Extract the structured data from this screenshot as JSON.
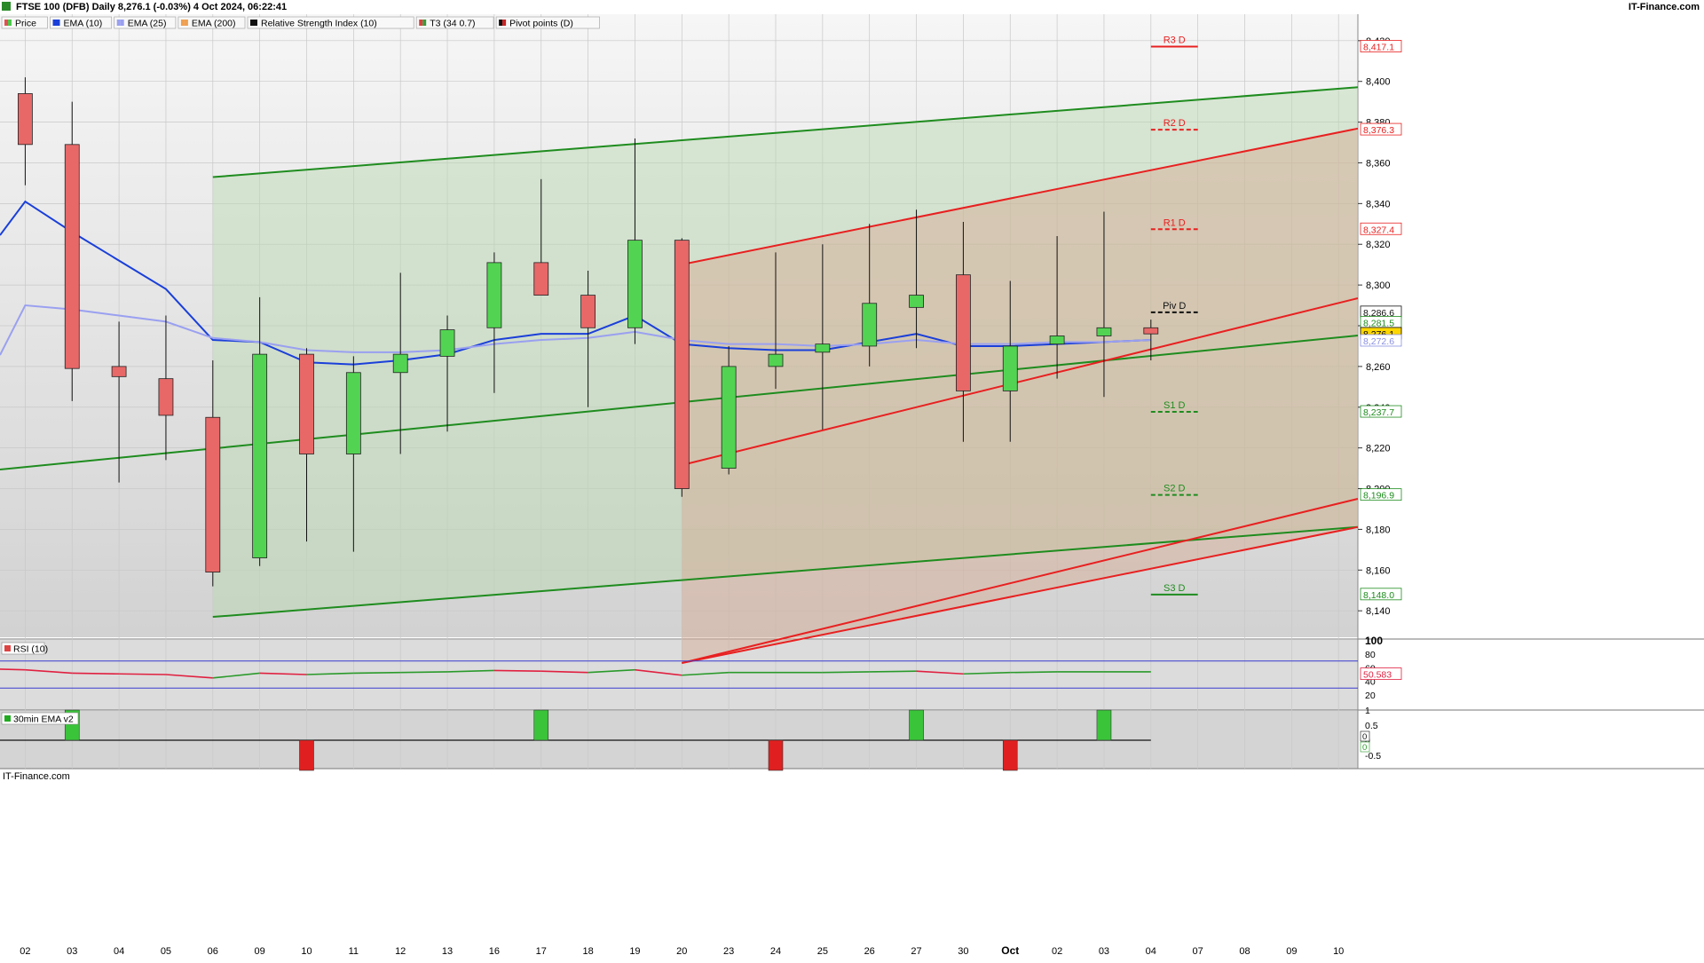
{
  "header": {
    "title": "FTSE 100 (DFB) Daily 8,276.1 (-0.03%) 4 Oct 2024, 06:22:41",
    "brand": "IT-Finance.com",
    "watermark": "IT-Finance.com"
  },
  "legend": [
    {
      "label": "Price",
      "color": "#e05252",
      "color2": "#4cc84c"
    },
    {
      "label": "EMA (10)",
      "color": "#1a3fd9"
    },
    {
      "label": "EMA (25)",
      "color": "#9aa0f0"
    },
    {
      "label": "EMA (200)",
      "color": "#f0a050"
    },
    {
      "label": "Relative Strength Index (10)",
      "color": "#111111"
    },
    {
      "label": "T3 (34 0.7)",
      "color": "#d94040",
      "color2": "#3a9a3a"
    },
    {
      "label": "Pivot points (D)",
      "color": "#111111",
      "color2": "#cc2222"
    }
  ],
  "colors": {
    "up": "#52d452",
    "down": "#e86868",
    "ema10": "#1a3fd9",
    "ema25": "#9aa0f0",
    "green_line": "#1e8c1e",
    "red_line": "#e82020",
    "rsi_up": "#2a9a2a",
    "rsi_down": "#e02040"
  },
  "chart_data": {
    "type": "candlestick",
    "x_tick_labels": [
      "02",
      "03",
      "04",
      "05",
      "06",
      "09",
      "10",
      "11",
      "12",
      "13",
      "16",
      "17",
      "18",
      "19",
      "20",
      "23",
      "24",
      "25",
      "26",
      "27",
      "30",
      "Oct",
      "02",
      "03",
      "04",
      "07",
      "08",
      "09",
      "10"
    ],
    "y_ticks": [
      "8,140",
      "8,160",
      "8,180",
      "8,200",
      "8,220",
      "8,240",
      "8,260",
      "8,280",
      "8,300",
      "8,320",
      "8,340",
      "8,360",
      "8,380",
      "8,400",
      "8,420"
    ],
    "ylim": [
      8127,
      8433
    ],
    "candles": [
      {
        "o": 8394,
        "h": 8402,
        "l": 8349,
        "c": 8369
      },
      {
        "o": 8369,
        "h": 8390,
        "l": 8243,
        "c": 8259
      },
      {
        "o": 8260,
        "h": 8282,
        "l": 8203,
        "c": 8255
      },
      {
        "o": 8254,
        "h": 8285,
        "l": 8214,
        "c": 8236
      },
      {
        "o": 8235,
        "h": 8263,
        "l": 8152,
        "c": 8159
      },
      {
        "o": 8166,
        "h": 8294,
        "l": 8162,
        "c": 8266
      },
      {
        "o": 8266,
        "h": 8269,
        "l": 8174,
        "c": 8217
      },
      {
        "o": 8217,
        "h": 8265,
        "l": 8169,
        "c": 8257
      },
      {
        "o": 8257,
        "h": 8306,
        "l": 8217,
        "c": 8266
      },
      {
        "o": 8265,
        "h": 8285,
        "l": 8228,
        "c": 8278
      },
      {
        "o": 8279,
        "h": 8316,
        "l": 8247,
        "c": 8311
      },
      {
        "o": 8311,
        "h": 8352,
        "l": 8305,
        "c": 8295
      },
      {
        "o": 8295,
        "h": 8307,
        "l": 8240,
        "c": 8279
      },
      {
        "o": 8279,
        "h": 8372,
        "l": 8271,
        "c": 8322
      },
      {
        "o": 8322,
        "h": 8323,
        "l": 8196,
        "c": 8200
      },
      {
        "o": 8210,
        "h": 8270,
        "l": 8207,
        "c": 8260
      },
      {
        "o": 8260,
        "h": 8316,
        "l": 8249,
        "c": 8266
      },
      {
        "o": 8267,
        "h": 8320,
        "l": 8229,
        "c": 8271
      },
      {
        "o": 8270,
        "h": 8330,
        "l": 8260,
        "c": 8291
      },
      {
        "o": 8289,
        "h": 8337,
        "l": 8269,
        "c": 8295
      },
      {
        "o": 8305,
        "h": 8331,
        "l": 8223,
        "c": 8248
      },
      {
        "o": 8248,
        "h": 8302,
        "l": 8223,
        "c": 8270
      },
      {
        "o": 8271,
        "h": 8324,
        "l": 8254,
        "c": 8275
      },
      {
        "o": 8275,
        "h": 8336,
        "l": 8245,
        "c": 8279
      },
      {
        "o": 8279,
        "h": 8283,
        "l": 8263,
        "c": 8276
      }
    ],
    "ema10": [
      8341,
      8326,
      8312,
      8298,
      8273,
      8272,
      8262,
      8261,
      8263,
      8266,
      8273,
      8276,
      8276,
      8285,
      8271,
      8269,
      8268,
      8268,
      8272,
      8276,
      8270,
      8270,
      8271,
      8272,
      8273
    ],
    "ema25": [
      8290,
      8288,
      8285,
      8282,
      8274,
      8272,
      8268,
      8267,
      8267,
      8268,
      8271,
      8273,
      8274,
      8277,
      8273,
      8271,
      8271,
      8270,
      8271,
      8273,
      8271,
      8271,
      8272,
      8272,
      8273
    ],
    "ema_fills": {
      "upper_channel_start": 8353,
      "lower_channel_start": 8137
    },
    "price_labels": [
      {
        "text": "8,417.1",
        "value": 8417.1,
        "color": "#e82020",
        "bg": "#ffffff"
      },
      {
        "text": "8,376.3",
        "value": 8376.3,
        "color": "#e82020",
        "bg": "#ffffff"
      },
      {
        "text": "8,327.4",
        "value": 8327.4,
        "color": "#e82020",
        "bg": "#ffffff"
      },
      {
        "text": "8,286.6",
        "value": 8286.6,
        "color": "#111111",
        "bg": "#ffffff"
      },
      {
        "text": "8,281.5",
        "value": 8281.5,
        "color": "#1e8c1e",
        "bg": "#ffffff"
      },
      {
        "text": "8,276.1",
        "value": 8276.1,
        "color": "#000000",
        "bg": "#ffd700"
      },
      {
        "text": "8,272.6",
        "value": 8272.6,
        "color": "#8a90e0",
        "bg": "#ffffff"
      },
      {
        "text": "8,237.7",
        "value": 8237.7,
        "color": "#1e8c1e",
        "bg": "#ffffff"
      },
      {
        "text": "8,196.9",
        "value": 8196.9,
        "color": "#1e8c1e",
        "bg": "#ffffff"
      },
      {
        "text": "8,148.0",
        "value": 8148.0,
        "color": "#1e8c1e",
        "bg": "#ffffff"
      }
    ],
    "pivots": [
      {
        "label": "R3 D",
        "value": 8417.1,
        "color": "#e82020",
        "dashed": false
      },
      {
        "label": "R2 D",
        "value": 8376.3,
        "color": "#e82020",
        "dashed": true
      },
      {
        "label": "R1 D",
        "value": 8327.4,
        "color": "#e82020",
        "dashed": true
      },
      {
        "label": "Piv D",
        "value": 8286.6,
        "color": "#111111",
        "dashed": true
      },
      {
        "label": "S1 D",
        "value": 8237.7,
        "color": "#1e8c1e",
        "dashed": true
      },
      {
        "label": "S2 D",
        "value": 8196.9,
        "color": "#1e8c1e",
        "dashed": true
      },
      {
        "label": "S3 D",
        "value": 8148.0,
        "color": "#1e8c1e",
        "dashed": false
      }
    ],
    "rsi": {
      "label": "RSI (10)",
      "y_ticks": [
        "100",
        "80",
        "60",
        "40",
        "20"
      ],
      "last_value": "50.583",
      "overbought": 70,
      "oversold": 30,
      "values": [
        57,
        52,
        51,
        50,
        45,
        52,
        50,
        52,
        53,
        54,
        56,
        55,
        53,
        57,
        49,
        53,
        53,
        53,
        54,
        55,
        51,
        53,
        54,
        54,
        54
      ]
    },
    "osc": {
      "label": "30min EMA v2",
      "y_ticks": [
        "1",
        "0.5",
        "0",
        "-0.5"
      ],
      "right_tags": [
        "0",
        "0"
      ],
      "bars": [
        {
          "i": 1,
          "v": 1
        },
        {
          "i": 6,
          "v": -1
        },
        {
          "i": 11,
          "v": 1
        },
        {
          "i": 16,
          "v": -1
        },
        {
          "i": 19,
          "v": 1
        },
        {
          "i": 21,
          "v": -1
        },
        {
          "i": 23,
          "v": 1
        }
      ]
    }
  }
}
